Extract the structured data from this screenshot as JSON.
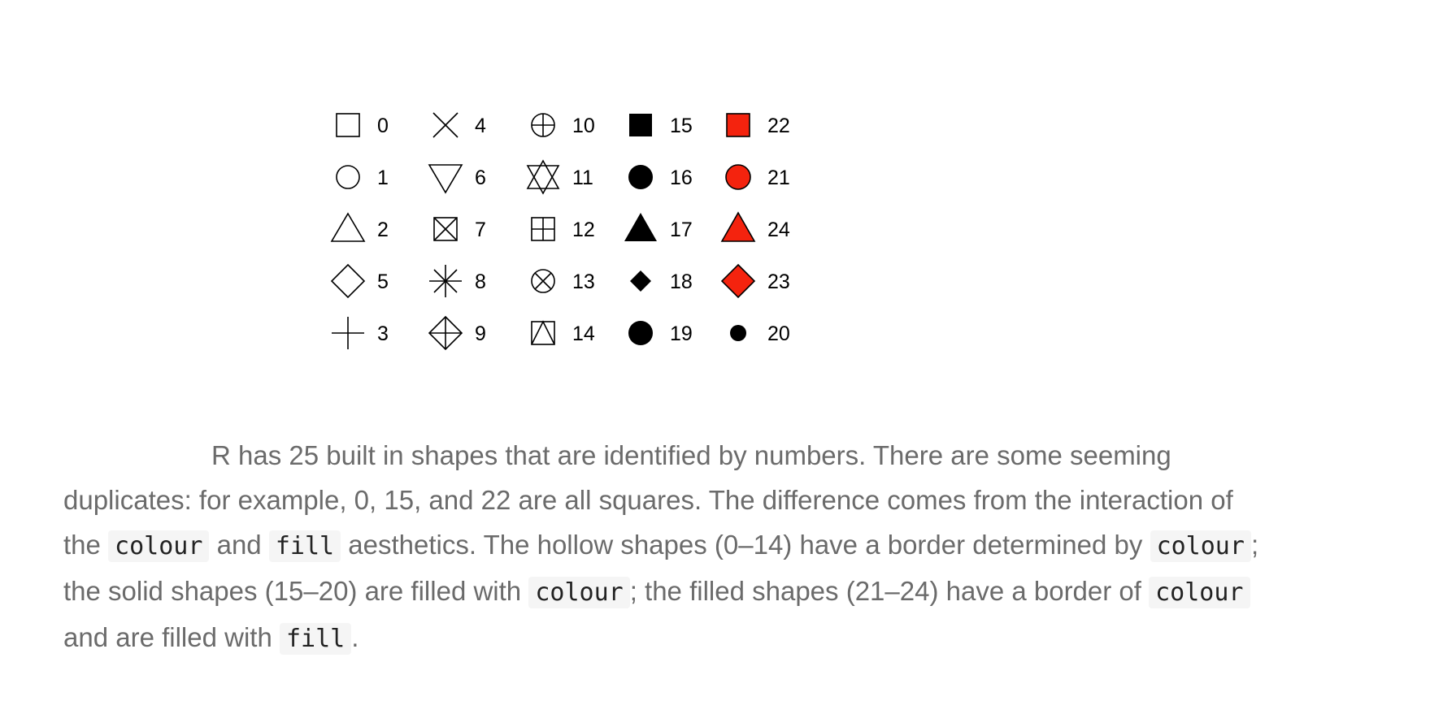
{
  "colors": {
    "outline": "#000000",
    "solid": "#000000",
    "fill_red": "#f4230e"
  },
  "shape_grid": {
    "columns": [
      [
        {
          "code": "0",
          "shape": "square-open"
        },
        {
          "code": "1",
          "shape": "circle-open"
        },
        {
          "code": "2",
          "shape": "triangle-open"
        },
        {
          "code": "5",
          "shape": "diamond-open"
        },
        {
          "code": "3",
          "shape": "plus"
        }
      ],
      [
        {
          "code": "4",
          "shape": "cross"
        },
        {
          "code": "6",
          "shape": "triangle-down-open"
        },
        {
          "code": "7",
          "shape": "square-cross"
        },
        {
          "code": "8",
          "shape": "asterisk"
        },
        {
          "code": "9",
          "shape": "diamond-plus"
        }
      ],
      [
        {
          "code": "10",
          "shape": "circle-plus"
        },
        {
          "code": "11",
          "shape": "star-of-david"
        },
        {
          "code": "12",
          "shape": "square-plus"
        },
        {
          "code": "13",
          "shape": "circle-cross"
        },
        {
          "code": "14",
          "shape": "square-triangle"
        }
      ],
      [
        {
          "code": "15",
          "shape": "square-solid"
        },
        {
          "code": "16",
          "shape": "circle-solid"
        },
        {
          "code": "17",
          "shape": "triangle-solid"
        },
        {
          "code": "18",
          "shape": "diamond-solid-small"
        },
        {
          "code": "19",
          "shape": "circle-solid"
        }
      ],
      [
        {
          "code": "22",
          "shape": "square-filled"
        },
        {
          "code": "21",
          "shape": "circle-filled"
        },
        {
          "code": "24",
          "shape": "triangle-filled"
        },
        {
          "code": "23",
          "shape": "diamond-filled"
        },
        {
          "code": "20",
          "shape": "circle-solid-small"
        }
      ]
    ]
  },
  "caption": {
    "line1": "R has 25 built in shapes that are identified by numbers. There are some seeming",
    "line2": "duplicates: for example, 0, 15, and 22 are all squares. The difference comes from the interaction of",
    "line3_a": "the ",
    "code_colour_1": "colour",
    "line3_b": " and ",
    "code_fill_1": "fill",
    "line3_c": " aesthetics. The hollow shapes (0–14) have a border determined by ",
    "code_colour_2": "colour",
    "line3_d": ";",
    "line4_a": "the solid shapes (15–20) are filled with ",
    "code_colour_3": "colour",
    "line4_b": "; the filled shapes (21–24) have a border of ",
    "code_colour_4": "colour",
    "line5_a": "and are filled with ",
    "code_fill_2": "fill",
    "line5_b": "."
  }
}
